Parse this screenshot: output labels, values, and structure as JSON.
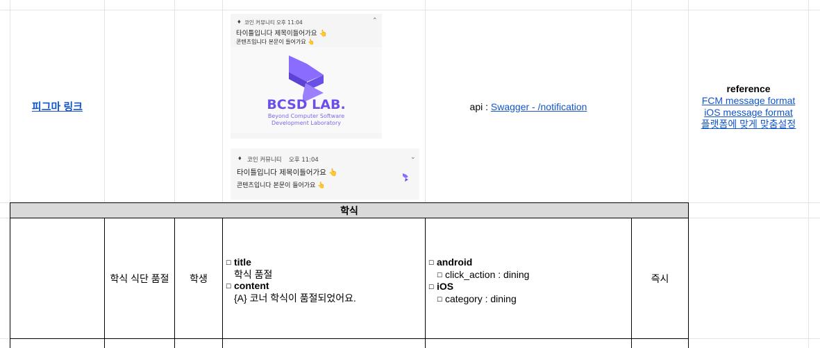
{
  "figma": {
    "link_label": "피그마 링크"
  },
  "preview": {
    "collapsed": {
      "app_name": "코인 커뮤니티",
      "time": "오후 11:04",
      "title": "타이틀입니다 제목이들어가요 👆",
      "content": "콘텐츠입니다 본문이 들어가요 👆",
      "logo_title": "BCSD LAB.",
      "logo_sub1": "Beyond Computer Software",
      "logo_sub2": "Development Laboratory"
    },
    "expanded": {
      "app_name": "코인 커뮤니티",
      "time": "오후 11:04",
      "title": "타이틀입니다 제목이들어가요 👆",
      "content": "콘텐츠입니다 본문이 들어가요 👆"
    }
  },
  "api": {
    "prefix": "api : ",
    "link_label": "Swagger - /notification"
  },
  "reference": {
    "heading": "reference",
    "links": [
      "FCM message format",
      "iOS message format",
      "플랫폼에 맞게 맞춤설정"
    ]
  },
  "section": {
    "title": "학식"
  },
  "row": {
    "type": "학식 식단 품절",
    "target": "학생",
    "title_key": "title",
    "title_value": "학식 품절",
    "content_key": "content",
    "content_value": "{A} 코너 학식이 품절되었어요.",
    "android_key": "android",
    "android_value": "click_action : dining",
    "ios_key": "iOS",
    "ios_value": "category : dining",
    "timing": "즉시"
  },
  "colors": {
    "brand": "#7b61ff",
    "link": "#1155cc",
    "section_bg": "#d9d9d9"
  }
}
